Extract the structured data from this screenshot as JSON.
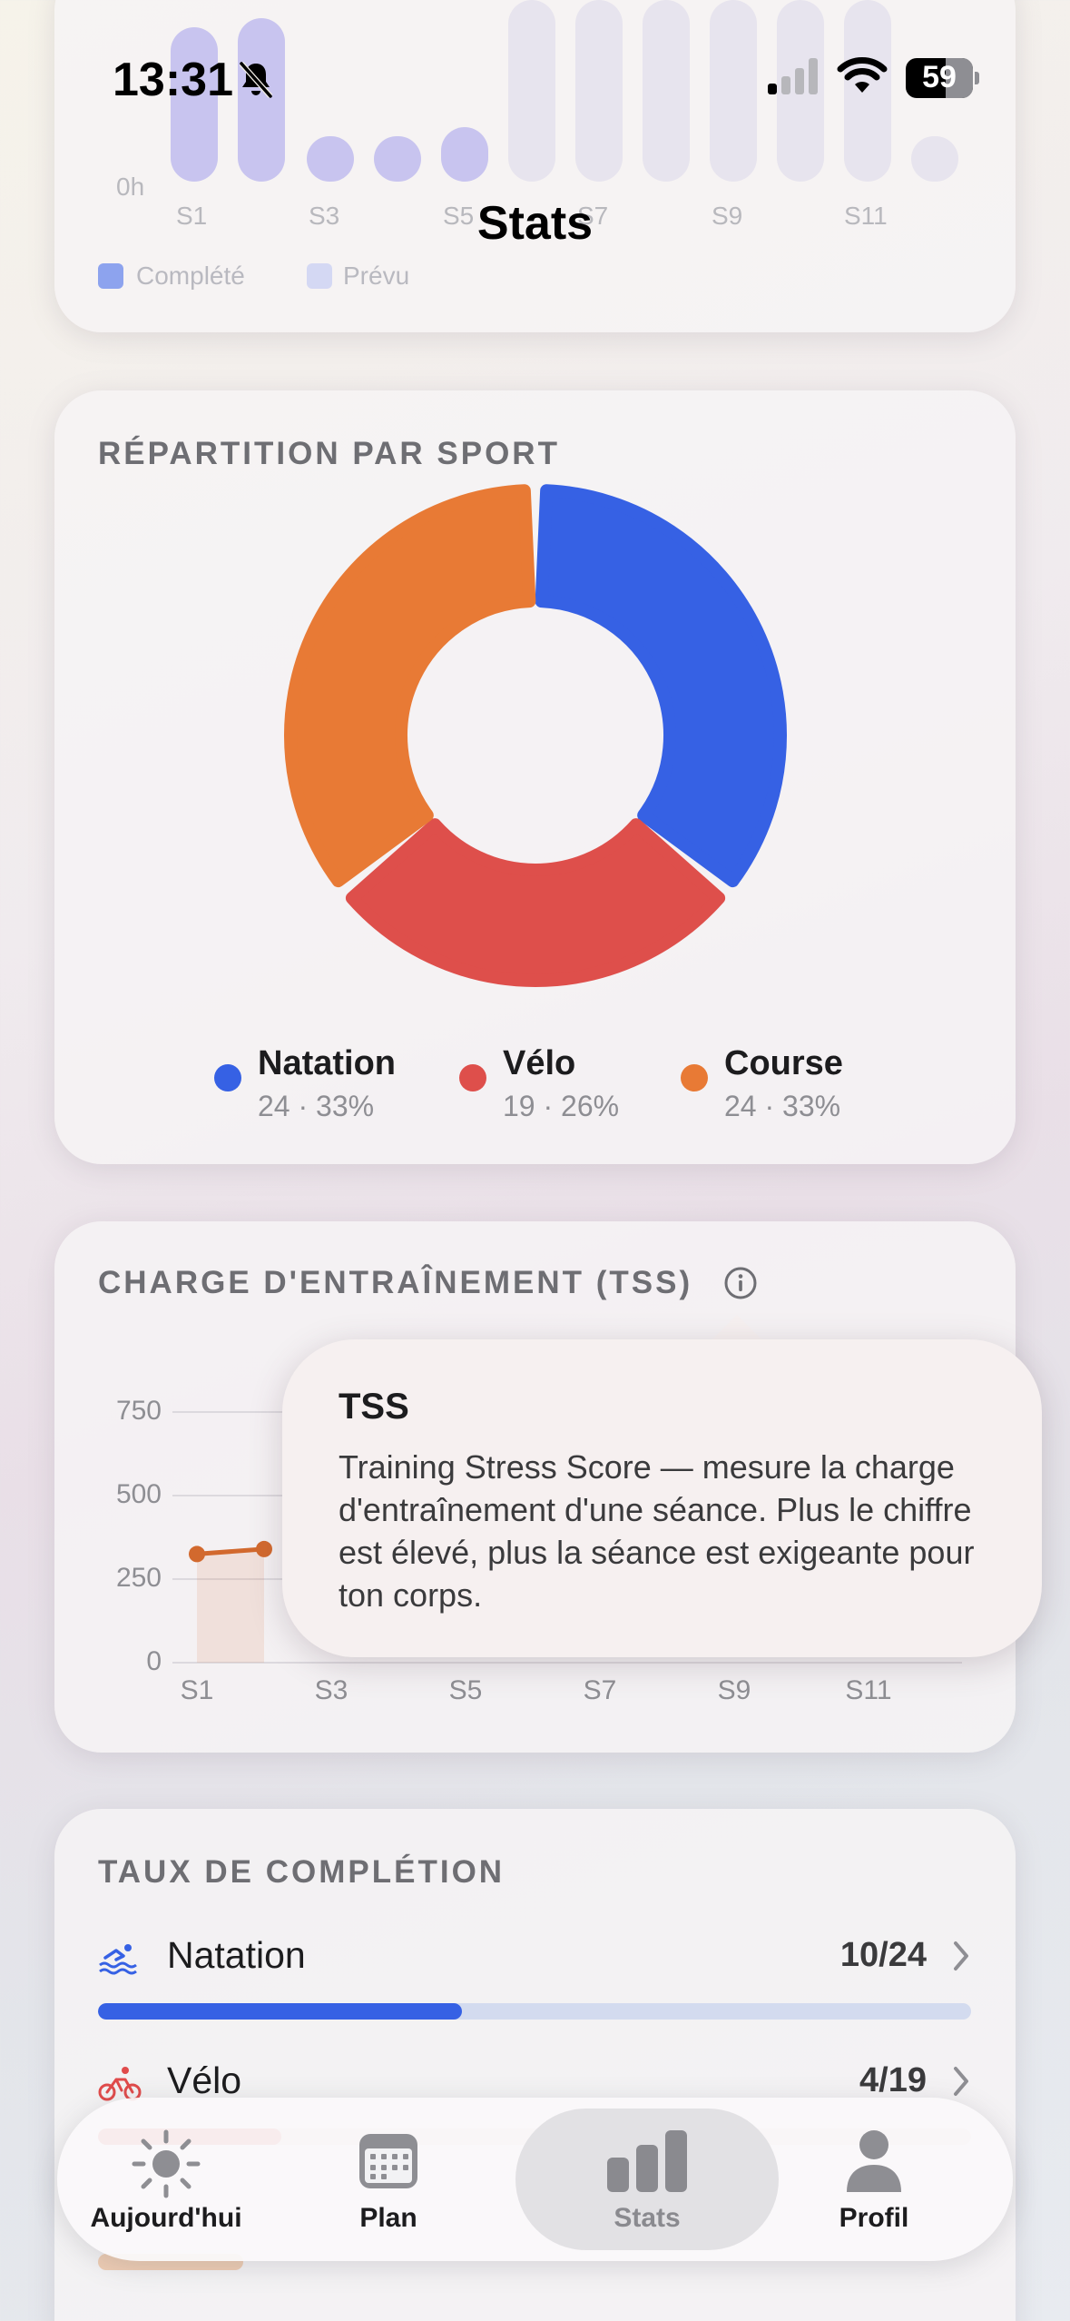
{
  "status_bar": {
    "time": "13:31",
    "battery": "59"
  },
  "nav": {
    "title": "Stats"
  },
  "weekly_card": {
    "x_labels": [
      "S1",
      "S3",
      "S5",
      "S7",
      "S9",
      "S11"
    ],
    "y_label": "0h",
    "legend": [
      {
        "label": "Complété",
        "color": "#3b63e0"
      },
      {
        "label": "Prévu",
        "color": "#c7cdf2"
      }
    ]
  },
  "sport_split": {
    "title": "RÉPARTITION PAR SPORT",
    "legend": [
      {
        "name": "Natation",
        "sub": "24 · 33%",
        "color": "#3661e4"
      },
      {
        "name": "Vélo",
        "sub": "19 · 26%",
        "color": "#de4f4b"
      },
      {
        "name": "Course",
        "sub": "24 · 33%",
        "color": "#e87a35"
      }
    ]
  },
  "tss": {
    "title": "CHARGE D'ENTRAÎNEMENT (TSS)",
    "y_ticks": [
      "750",
      "500",
      "250",
      "0"
    ],
    "x_ticks": [
      "S1",
      "S3",
      "S5",
      "S7",
      "S9",
      "S11"
    ],
    "line_color": "#d2692e",
    "tooltip": {
      "title": "TSS",
      "body": "Training Stress Score — mesure la charge d'entraînement d'une séance. Plus le chiffre est élevé, plus la séance est exigeante pour ton corps."
    }
  },
  "chart_data": {
    "type": "line",
    "title": "CHARGE D'ENTRAÎNEMENT (TSS)",
    "x": [
      "S1",
      "S2"
    ],
    "series": [
      {
        "values": [
          325,
          340
        ]
      }
    ],
    "ylim": [
      0,
      750
    ],
    "y_ticks": [
      0,
      250,
      500,
      750
    ],
    "x_tick_labels": [
      "S1",
      "S3",
      "S5",
      "S7",
      "S9",
      "S11"
    ],
    "grid": true
  },
  "completion": {
    "title": "TAUX DE COMPLÉTION",
    "rows": [
      {
        "name": "Natation",
        "count": "10/24",
        "progress": 0.417,
        "color": "#3661e4",
        "icon": "swim-icon"
      },
      {
        "name": "Vélo",
        "count": "4/19",
        "progress": 0.21,
        "color": "#e04b4b",
        "icon": "bike-icon"
      }
    ]
  },
  "tab_bar": {
    "tabs": [
      {
        "label": "Aujourd'hui",
        "icon": "sun-icon"
      },
      {
        "label": "Plan",
        "icon": "calendar-icon"
      },
      {
        "label": "Stats",
        "icon": "bar-chart-icon",
        "active": true
      },
      {
        "label": "Profil",
        "icon": "person-icon"
      }
    ]
  }
}
